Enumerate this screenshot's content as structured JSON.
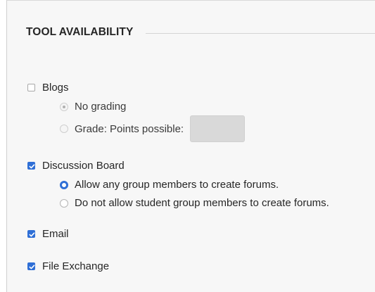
{
  "section": {
    "title": "TOOL AVAILABILITY"
  },
  "tools": {
    "blogs": {
      "label": "Blogs",
      "checked": false,
      "options": {
        "no_grading": "No grading",
        "grade_points": "Grade: Points possible:"
      },
      "points_value": ""
    },
    "discussion_board": {
      "label": "Discussion Board",
      "checked": true,
      "options": {
        "allow_create": "Allow any group members to create forums.",
        "disallow_create": "Do not allow student group members to create forums."
      }
    },
    "email": {
      "label": "Email",
      "checked": true
    },
    "file_exchange": {
      "label": "File Exchange",
      "checked": true
    }
  },
  "colors": {
    "accent": "#2f6fd6",
    "panel_background": "#f7f7f7",
    "disabled_input": "#d9d9d9"
  }
}
